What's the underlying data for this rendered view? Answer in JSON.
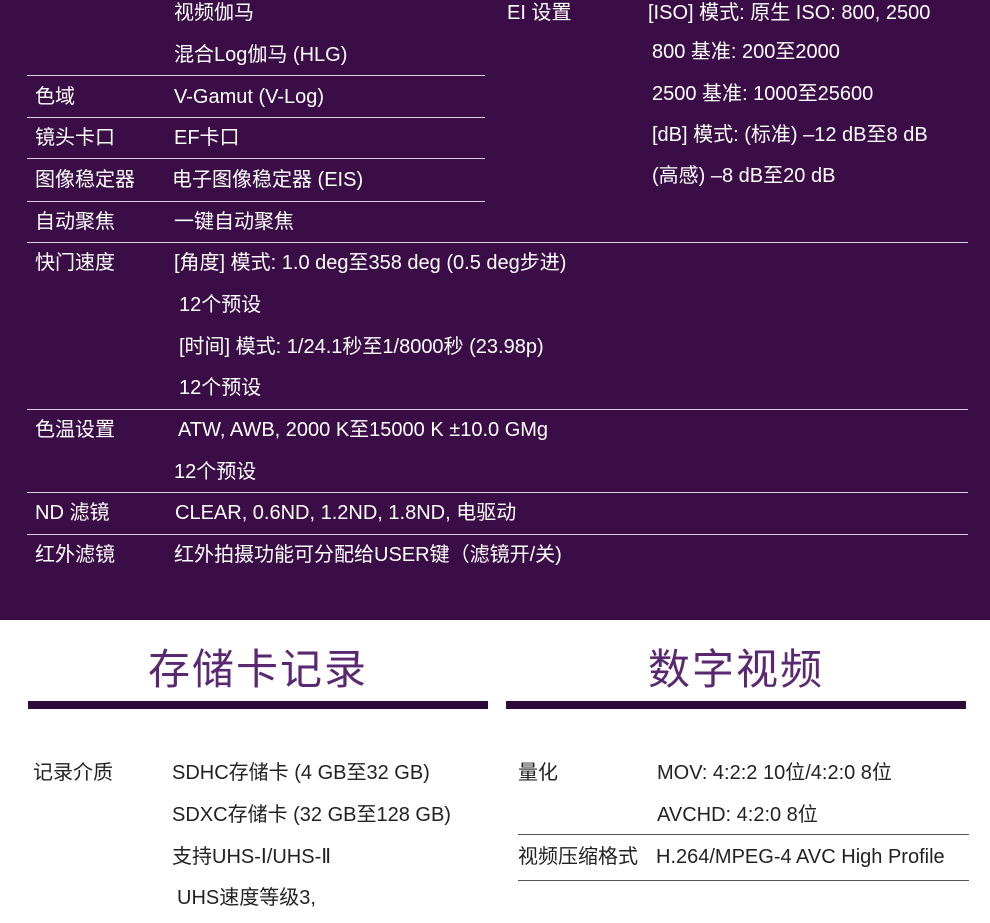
{
  "top": {
    "rows": {
      "gamma": {
        "values": [
          "视频伽马",
          "混合Log伽马 (HLG)"
        ]
      },
      "color_space": {
        "label": "色域",
        "value": "V-Gamut (V-Log)"
      },
      "lens_mount": {
        "label": "镜头卡口",
        "value": "EF卡口"
      },
      "stabilizer": {
        "label": "图像稳定器",
        "value": "电子图像稳定器 (EIS)"
      },
      "autofocus": {
        "label": "自动聚焦",
        "value": "一键自动聚焦"
      },
      "shutter": {
        "label": "快门速度",
        "values": [
          "[角度] 模式: 1.0 deg至358 deg (0.5 deg步进)",
          "12个预设",
          "[时间] 模式: 1/24.1秒至1/8000秒 (23.98p)",
          "12个预设"
        ]
      },
      "white_balance": {
        "label": "色温设置",
        "values": [
          "ATW, AWB, 2000 K至15000 K ±10.0 GMg",
          "12个预设"
        ]
      },
      "nd_filter": {
        "label": "ND 滤镜",
        "value": "CLEAR, 0.6ND, 1.2ND, 1.8ND, 电驱动"
      },
      "ir_filter": {
        "label": "红外滤镜",
        "value": "红外拍摄功能可分配给USER键（滤镜开/关)"
      }
    },
    "ei": {
      "label": "EI 设置",
      "values": [
        "[ISO] 模式: 原生 ISO: 800, 2500",
        "800 基准: 200至2000",
        "2500 基准: 1000至25600",
        "[dB] 模式: (标准) –12 dB至8 dB",
        "(高感) –8 dB至20 dB"
      ]
    }
  },
  "sections": {
    "card": {
      "heading": "存储卡记录",
      "media": {
        "label": "记录介质",
        "values": [
          "SDHC存储卡 (4 GB至32 GB)",
          "SDXC存储卡 (32 GB至128 GB)",
          "支持UHS-Ⅰ/UHS-Ⅱ",
          "UHS速度等级3,"
        ]
      }
    },
    "video": {
      "heading": "数字视频",
      "quantization": {
        "label": "量化",
        "values": [
          "MOV: 4:2:2 10位/4:2:0 8位",
          "AVCHD: 4:2:0 8位"
        ]
      },
      "compression": {
        "label": "视频压缩格式",
        "value": "H.264/MPEG-4 AVC High Profile"
      }
    }
  },
  "colors": {
    "panel_background": "#3a0d46",
    "heading_text": "#5a2870",
    "heading_bar": "#2e0b3a"
  }
}
